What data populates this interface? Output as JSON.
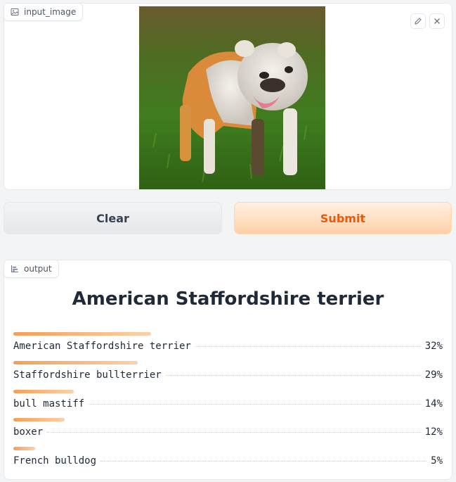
{
  "input": {
    "label": "input_image",
    "icon": "image-icon",
    "tools": [
      "edit-icon",
      "close-icon"
    ]
  },
  "buttons": {
    "clear": "Clear",
    "submit": "Submit"
  },
  "output": {
    "label": "output",
    "icon": "bar-chart-icon",
    "top_label": "American Staffordshire terrier",
    "confidences": [
      {
        "label": "American Staffordshire terrier",
        "value": "32%",
        "fraction": 0.32
      },
      {
        "label": "Staffordshire bullterrier",
        "value": "29%",
        "fraction": 0.29
      },
      {
        "label": "bull mastiff",
        "value": "14%",
        "fraction": 0.14
      },
      {
        "label": "boxer",
        "value": "12%",
        "fraction": 0.12
      },
      {
        "label": "French bulldog",
        "value": "5%",
        "fraction": 0.05
      }
    ]
  },
  "colors": {
    "accent": "#ea580c",
    "bar_start": "#f59e56",
    "bar_end": "#fdd0a8"
  }
}
